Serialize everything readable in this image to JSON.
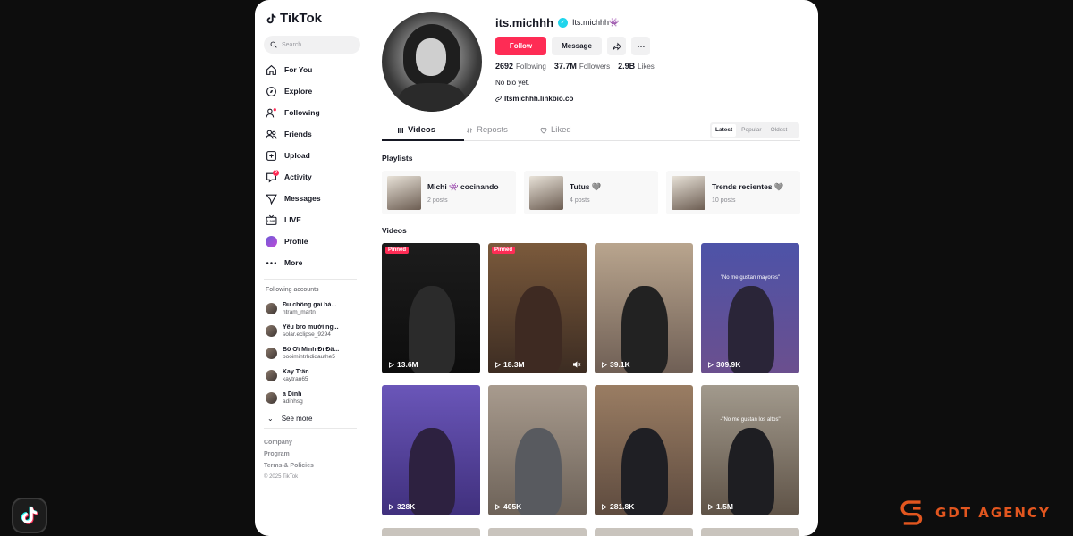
{
  "app": {
    "name": "TikTok"
  },
  "search": {
    "placeholder": "Search"
  },
  "nav": {
    "items": [
      {
        "label": "For You",
        "icon": "home-icon"
      },
      {
        "label": "Explore",
        "icon": "compass-icon"
      },
      {
        "label": "Following",
        "icon": "user-plus-icon"
      },
      {
        "label": "Friends",
        "icon": "friends-icon"
      },
      {
        "label": "Upload",
        "icon": "upload-icon"
      },
      {
        "label": "Activity",
        "icon": "inbox-icon",
        "badge": "9"
      },
      {
        "label": "Messages",
        "icon": "send-icon"
      },
      {
        "label": "LIVE",
        "icon": "live-icon"
      },
      {
        "label": "Profile",
        "icon": "avatar"
      },
      {
        "label": "More",
        "icon": "more-icon"
      }
    ]
  },
  "following_accounts": {
    "title": "Following accounts",
    "items": [
      {
        "name": "Đu chồng gai bả...",
        "username": "ntram_martn"
      },
      {
        "name": "Yêu bro mười ng...",
        "username": "solar.eclipse_9294"
      },
      {
        "name": "Bố Ơi Mình Đi Đâ...",
        "username": "booimintrhdidauthe5"
      },
      {
        "name": "Kay Trần",
        "username": "kaytran65"
      },
      {
        "name": "a Dinh",
        "username": "adinhsg"
      }
    ],
    "see_more": "See more"
  },
  "footer": {
    "company": "Company",
    "program": "Program",
    "terms": "Terms & Policies",
    "copyright": "© 2025 TikTok"
  },
  "profile": {
    "username": "its.michhh",
    "nickname": "Its.michhh👾",
    "follow_label": "Follow",
    "message_label": "Message",
    "following_count": "2692",
    "following_label": "Following",
    "followers_count": "37.7M",
    "followers_label": "Followers",
    "likes_count": "2.9B",
    "likes_label": "Likes",
    "bio": "No bio yet.",
    "link": "Itsmichhh.linkbio.co"
  },
  "tabs": [
    {
      "label": "Videos"
    },
    {
      "label": "Reposts"
    },
    {
      "label": "Liked"
    }
  ],
  "sort": {
    "latest": "Latest",
    "popular": "Popular",
    "oldest": "Oldest"
  },
  "sections": {
    "playlists": "Playlists",
    "videos": "Videos"
  },
  "playlists": [
    {
      "name": "Michi 👾 cocinando",
      "posts": "2 posts"
    },
    {
      "name": "Tutus 🩶",
      "posts": "4 posts"
    },
    {
      "name": "Trends recientes 🩶",
      "posts": "10 posts"
    }
  ],
  "videos": [
    {
      "views": "13.6M",
      "pinned": "Pinned",
      "caption": ""
    },
    {
      "views": "18.3M",
      "pinned": "Pinned",
      "caption": ""
    },
    {
      "views": "39.1K",
      "caption": ""
    },
    {
      "views": "309.9K",
      "caption": "\"No me gustan mayores\""
    },
    {
      "views": "328K",
      "caption": ""
    },
    {
      "views": "405K",
      "caption": ""
    },
    {
      "views": "281.8K",
      "caption": ""
    },
    {
      "views": "1.5M",
      "caption": "-\"No me gustan los altos\""
    }
  ],
  "brand": {
    "name": "GDT AGENCY"
  },
  "colors": {
    "accent": "#fe2c55",
    "verified": "#20d5ec",
    "brand": "#e2561f"
  }
}
